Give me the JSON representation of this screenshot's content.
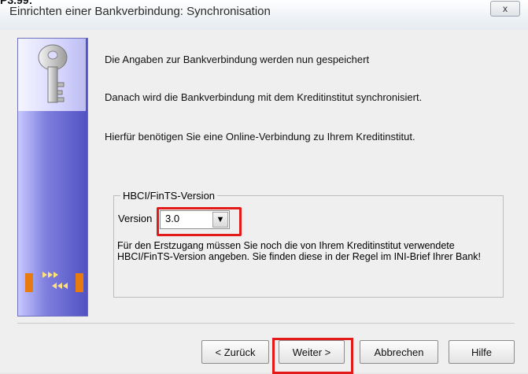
{
  "window": {
    "top_cut_text": "P3.99:",
    "title": "Einrichten einer Bankverbindung: Synchronisation",
    "close_label": "x"
  },
  "content": {
    "line1": "Die Angaben zur Bankverbindung werden nun gespeichert",
    "line2": "Danach wird die Bankverbindung mit dem Kreditinstitut synchronisiert.",
    "line3": "Hierfür benötigen Sie eine Online-Verbindung zu Ihrem Kreditinstitut."
  },
  "group": {
    "title": "HBCI/FinTS-Version",
    "version_label": "Version",
    "version_value": "3.0",
    "help_text": "Für den Erstzugang müssen Sie noch die von Ihrem Kreditinstitut verwendete HBCI/FinTS-Version angeben. Sie finden diese in der Regel im INI-Brief Ihrer Bank!"
  },
  "buttons": {
    "back": "< Zurück",
    "next": "Weiter >",
    "cancel": "Abbrechen",
    "help": "Hilfe"
  },
  "icons": {
    "side_top": "key-icon",
    "side_bottom": "sync-transfer-icon",
    "combo": "chevron-down-icon"
  },
  "colors": {
    "highlight": "#e21a1a",
    "side_panel": "#5a5ac7"
  }
}
